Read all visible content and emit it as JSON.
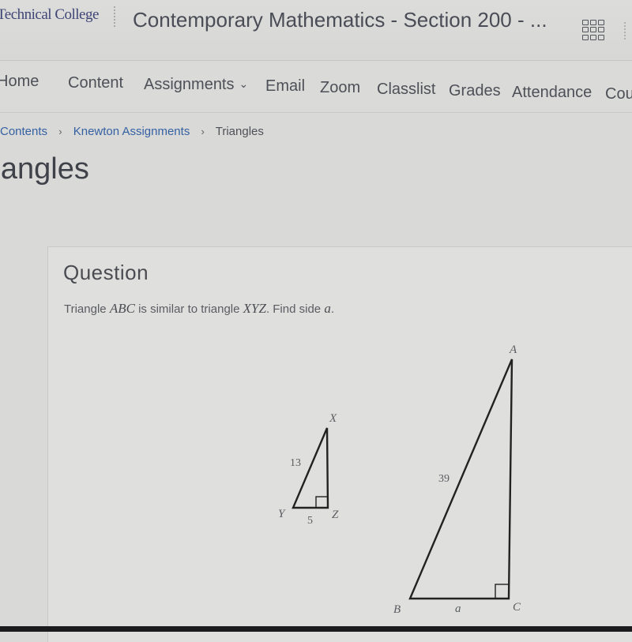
{
  "header": {
    "college_name": "Technical College",
    "course_title": "Contemporary Mathematics - Section 200 - ...",
    "apps_icon": "grid-icon"
  },
  "nav": {
    "items": [
      {
        "label": "Home"
      },
      {
        "label": "Content"
      },
      {
        "label": "Assignments",
        "has_dropdown": true
      },
      {
        "label": "Email"
      },
      {
        "label": "Zoom"
      },
      {
        "label": "Classlist"
      },
      {
        "label": "Grades"
      },
      {
        "label": "Attendance"
      },
      {
        "label": "Cou"
      }
    ],
    "dropdown_glyph": "⌄"
  },
  "breadcrumb": {
    "items": [
      {
        "label": "Contents",
        "link": true
      },
      {
        "label": "Knewton Assignments",
        "link": true
      },
      {
        "label": "Triangles",
        "link": false
      }
    ],
    "separator": "›"
  },
  "page": {
    "title": "Triangles"
  },
  "question": {
    "heading": "Question",
    "text_parts": [
      "Triangle ",
      "ABC",
      " is similar to triangle ",
      "XYZ",
      ". Find side ",
      "a",
      "."
    ]
  },
  "figure": {
    "small_triangle": {
      "vertices": {
        "top": "X",
        "left": "Y",
        "right": "Z"
      },
      "hypotenuse_label": "13",
      "base_label": "5"
    },
    "large_triangle": {
      "vertices": {
        "top": "A",
        "left": "B",
        "right": "C"
      },
      "hypotenuse_label": "39",
      "base_label": "a"
    }
  }
}
